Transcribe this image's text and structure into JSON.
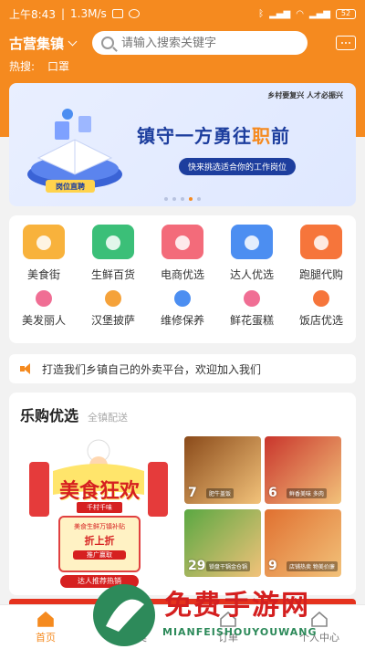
{
  "status": {
    "time": "上午8:43",
    "speed": "1.3M/s",
    "battery": "52"
  },
  "header": {
    "town": "古营集镇",
    "search_placeholder": "请输入搜索关键字",
    "hot_label": "热搜:",
    "hot_items": [
      "口罩"
    ]
  },
  "banner": {
    "top_text": "乡村要复兴 人才必振兴",
    "title_a": "镇守一方勇往",
    "title_hl": "职",
    "title_b": "前",
    "subtitle": "快来挑选适合你的工作岗位",
    "badge": "岗位直聘",
    "active_dot": 3
  },
  "categories_main": [
    {
      "label": "美食街",
      "icon": "food-dome-icon",
      "color": "#f8b23c"
    },
    {
      "label": "生鲜百货",
      "icon": "basket-icon",
      "color": "#3bbf78"
    },
    {
      "label": "电商优选",
      "icon": "shopping-bag-icon",
      "color": "#f36b7a"
    },
    {
      "label": "达人优选",
      "icon": "graduation-cap-icon",
      "color": "#4c8ef1"
    },
    {
      "label": "跑腿代购",
      "icon": "runner-icon",
      "color": "#f6753b"
    }
  ],
  "categories_secondary": [
    {
      "label": "美发丽人",
      "icon": "beauty-icon",
      "color": "#f06e94"
    },
    {
      "label": "汉堡披萨",
      "icon": "burger-icon",
      "color": "#f5a23a"
    },
    {
      "label": "维修保养",
      "icon": "tools-icon",
      "color": "#4c8ef1"
    },
    {
      "label": "鲜花蛋糕",
      "icon": "flower-icon",
      "color": "#f06e94"
    },
    {
      "label": "饭店优选",
      "icon": "restaurant-icon",
      "color": "#f6753b"
    }
  ],
  "notice": {
    "text": "打造我们乡镇自己的外卖平台，欢迎加入我们"
  },
  "featured": {
    "title": "乐购优选",
    "subtitle": "全镇配送",
    "poster_title": "美食狂欢",
    "poster_ribbon": "千村千味",
    "poster_line1": "美食生鲜万镇补贴",
    "poster_line2": "折上折",
    "poster_line3": "推广赢取",
    "poster_button": "达人推荐热销",
    "tiles": [
      {
        "num": "7",
        "tag": "肥牛盖饭",
        "color": "#8a4a1a"
      },
      {
        "num": "6",
        "tag": "鲜香美味 多肉",
        "color": "#c9352c"
      },
      {
        "num": "29",
        "tag": "锁盘干锅金仓锅",
        "color": "#5aa842"
      },
      {
        "num": "9",
        "tag": "店铺热卖 物美价廉",
        "color": "#e07030"
      }
    ]
  },
  "bottom_nav": [
    {
      "label": "首页",
      "icon": "home-icon",
      "active": true
    },
    {
      "label": "分类",
      "icon": "category-icon",
      "active": false
    },
    {
      "label": "订单",
      "icon": "order-icon",
      "active": false
    },
    {
      "label": "个人中心",
      "icon": "user-icon",
      "active": false
    }
  ],
  "watermark": {
    "text": "免费手游网",
    "sub": "MIANFEISHOUYOUWANG"
  }
}
